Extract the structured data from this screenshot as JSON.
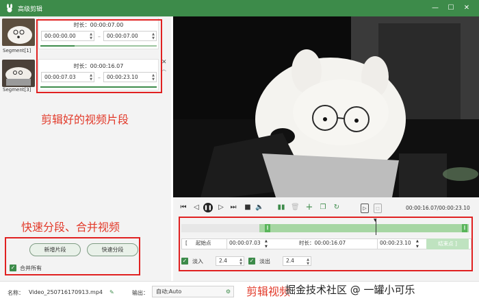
{
  "window": {
    "title": "高级剪辑",
    "icon": "rabbit-icon"
  },
  "segments": [
    {
      "label": "Segment[1]",
      "duration": "时长：00:00:07.00",
      "start": "00:00:00.00",
      "end": "00:00:07.00"
    },
    {
      "label": "Segment[3]",
      "duration": "时长：00:00:16.07",
      "start": "00:00:07.03",
      "end": "00:00:23.10"
    }
  ],
  "annotations": {
    "clips": "剪辑好的视频片段",
    "split_merge": "快速分段、合并视频",
    "edit": "剪辑视频"
  },
  "buttons": {
    "add_segment": "新增片段",
    "quick_split": "快速分段",
    "merge_all": "合并所有"
  },
  "player": {
    "time_readout": "00:00:16.07/00:00:23.10"
  },
  "trim": {
    "start_label": "起始点",
    "start_time": "00:00:07.03",
    "duration": "时长：00:00:16.07",
    "end_time": "00:00:23.10",
    "end_label": "结束点",
    "fade_in_label": "淡入",
    "fade_in": "2.4",
    "fade_out_label": "淡出",
    "fade_out": "2.4"
  },
  "footer": {
    "name_label": "名称：",
    "file_name": "Video_250716170913.mp4",
    "output_label": "输出：",
    "output_value": "自动;Auto"
  },
  "watermark": "掘金技术社区 @ 一罐小可乐",
  "colors": {
    "accent": "#3d8b4a",
    "annotation": "#e23a2a",
    "highlight_box": "#e02020"
  }
}
